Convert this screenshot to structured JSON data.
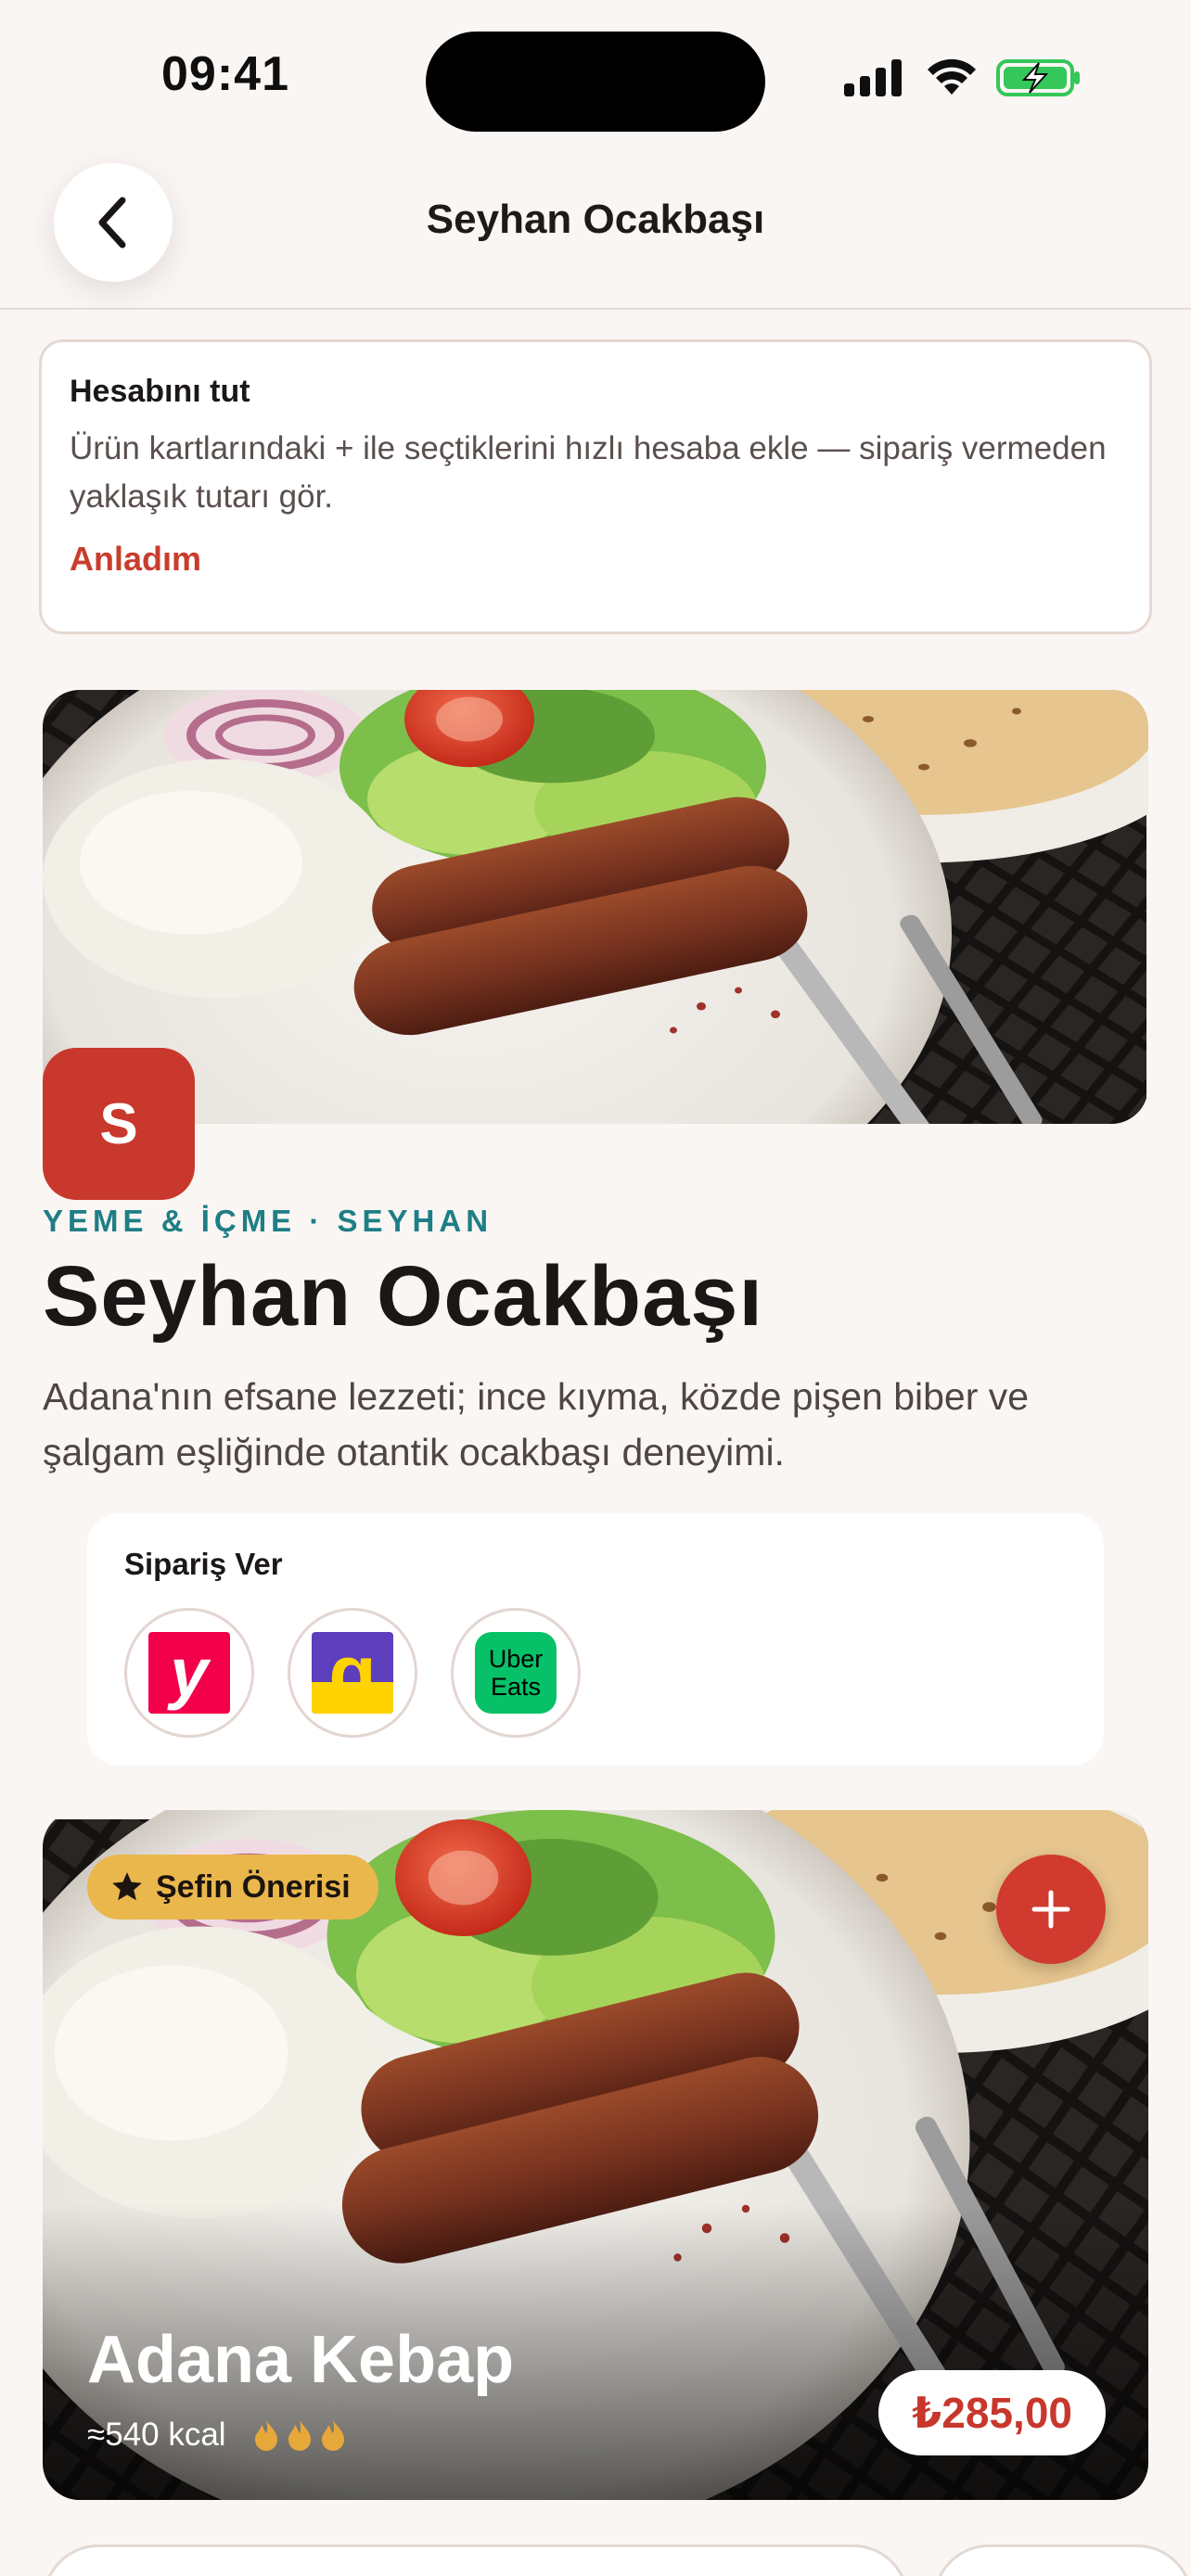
{
  "status": {
    "time": "09:41"
  },
  "nav": {
    "title": "Seyhan Ocakbaşı",
    "back_icon": "chevron-left-icon"
  },
  "tip": {
    "title": "Hesabını tut",
    "body": "Ürün kartlarındaki + ile seçtiklerini hızlı hesaba ekle — sipariş vermeden yaklaşık tutarı gör.",
    "action": "Anladım"
  },
  "venue": {
    "logo_letter": "S",
    "category": "YEME & İÇME · SEYHAN",
    "title": "Seyhan Ocakbaşı",
    "description": "Adana'nın efsane lezzeti; ince kıyma, közde pişen biber ve şalgam eşliğinde otantik ocakbaşı deneyimi."
  },
  "order": {
    "title": "Sipariş Ver",
    "providers": [
      {
        "logo_text": "y",
        "color": "#f2004a"
      },
      {
        "logo_text": "g",
        "color": "#5d3ebc"
      },
      {
        "logo_text": "Uber Eats",
        "color": "#06c167"
      }
    ]
  },
  "dish": {
    "badge": "Şefin Önerisi",
    "name": "Adana Kebap",
    "calories": "≈540 kcal",
    "spice_level": 3,
    "price": "₺285,00"
  },
  "colors": {
    "accent": "#c93d2d",
    "teal": "#1e7e85",
    "badge": "#e9b74c",
    "background": "#faf6f4"
  }
}
